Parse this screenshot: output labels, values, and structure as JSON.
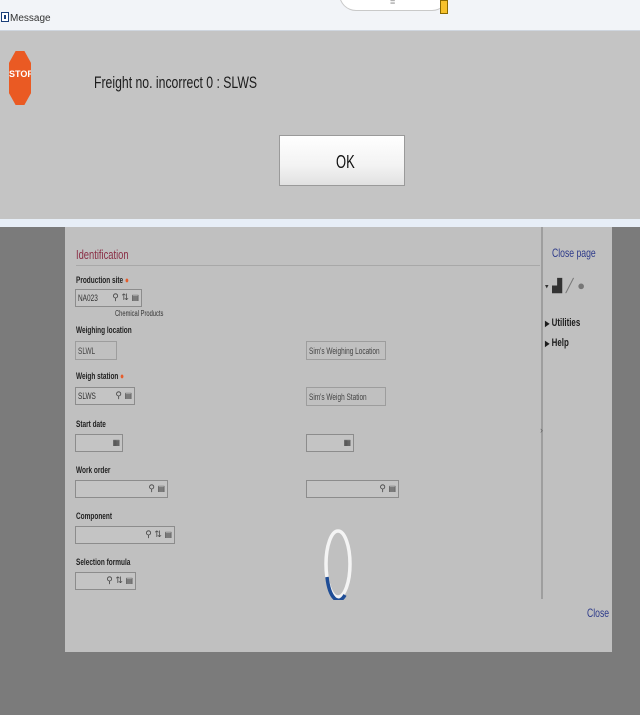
{
  "dialog": {
    "title": "Message",
    "message": "Freight no. incorrect  0 : SLWS",
    "ok_label": "OK",
    "stop_icon_text": "STOP",
    "handle_glyph": "≡"
  },
  "page": {
    "section_title": "Identification",
    "fields": {
      "production_site": {
        "label": "Production site",
        "value": "NA023",
        "description": "Chemical Products"
      },
      "weighing_location": {
        "label": "Weighing location",
        "value": "SLWL",
        "description": "Sim's Weighing Location"
      },
      "weigh_station": {
        "label": "Weigh station",
        "value": "SLWS",
        "description": "Sim's Weigh Station"
      },
      "start_date": {
        "label": "Start date",
        "value": ""
      },
      "work_order": {
        "label": "Work order",
        "value": ""
      },
      "component": {
        "label": "Component",
        "value": ""
      },
      "selection_formula": {
        "label": "Selection formula",
        "value": ""
      }
    }
  },
  "sidebar": {
    "close_page": "Close page",
    "utilities": "Utilities",
    "help": "Help"
  },
  "footer": {
    "close": "Close"
  },
  "colors": {
    "section_title": "#8a2e45",
    "link": "#2d3a8a",
    "required": "#e65d2c",
    "stop": "#ea5a23",
    "spinner": "#1f4d96"
  }
}
